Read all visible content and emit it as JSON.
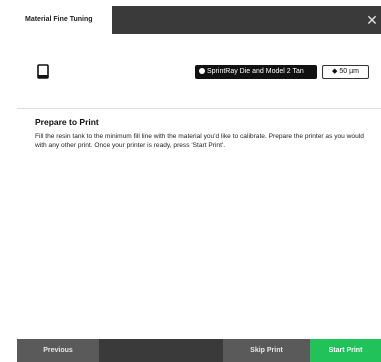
{
  "dialog": {
    "tab_title": "Material Fine Tuning",
    "close_glyph": "✕"
  },
  "device": {
    "printer_icon": "printer-icon",
    "resin_label": "SprintRay Die and Model 2 Tan",
    "layer_label": "50 µm"
  },
  "content": {
    "heading": "Prepare to Print",
    "body": "Fill the resin tank to the minimum fill line with the material you'd like to calibrate. Prepare the printer as you would with any other print. Once your printer is ready, press 'Start Print'."
  },
  "footer": {
    "previous_label": "Previous",
    "skip_label": "Skip Print",
    "start_label": "Start Print"
  },
  "colors": {
    "accent_green": "#22c25a",
    "dark_bar": "#3a3a3a",
    "button_gray": "#5a5a5a"
  }
}
